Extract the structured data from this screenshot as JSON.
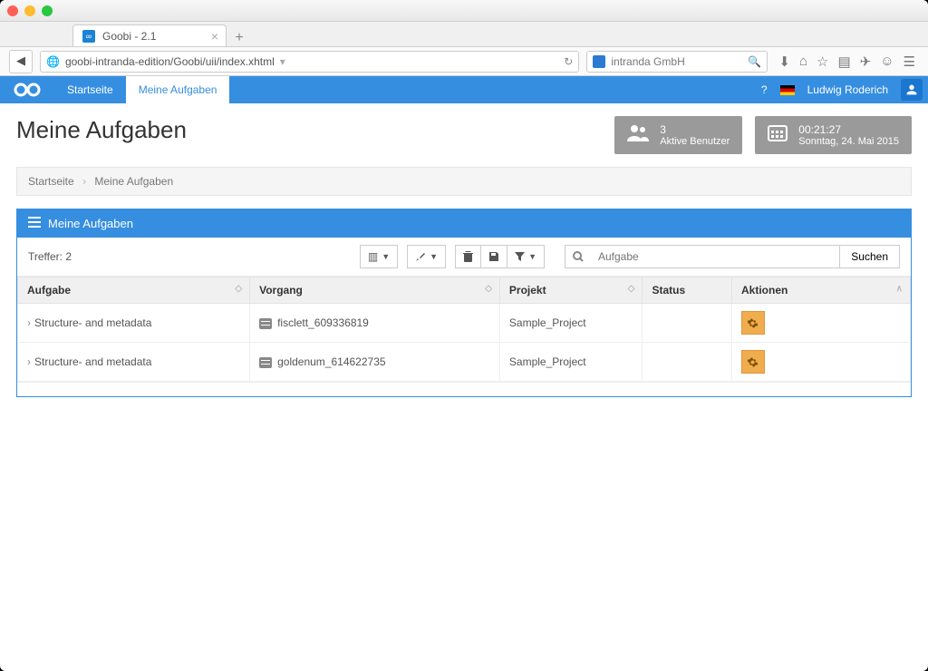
{
  "browser": {
    "tab_title": "Goobi - 2.1",
    "url": "goobi-intranda-edition/Goobi/uii/index.xhtml",
    "search_engine": "intranda GmbH"
  },
  "header": {
    "nav": {
      "home": "Startseite",
      "tasks": "Meine Aufgaben"
    },
    "help": "?",
    "username": "Ludwig Roderich"
  },
  "info_cards": {
    "users": {
      "count": "3",
      "label": "Aktive Benutzer"
    },
    "clock": {
      "time": "00:21:27",
      "date": "Sonntag, 24. Mai 2015"
    }
  },
  "page": {
    "title": "Meine Aufgaben",
    "breadcrumb": {
      "home": "Startseite",
      "current": "Meine Aufgaben"
    }
  },
  "panel": {
    "title": "Meine Aufgaben",
    "hits_label": "Treffer: 2",
    "search_placeholder": "Aufgabe",
    "search_button": "Suchen",
    "columns": {
      "task": "Aufgabe",
      "process": "Vorgang",
      "project": "Projekt",
      "status": "Status",
      "actions": "Aktionen"
    },
    "rows": [
      {
        "task": "Structure- and metadata",
        "process": "fisclett_609336819",
        "project": "Sample_Project"
      },
      {
        "task": "Structure- and metadata",
        "process": "goldenum_614622735",
        "project": "Sample_Project"
      }
    ]
  }
}
